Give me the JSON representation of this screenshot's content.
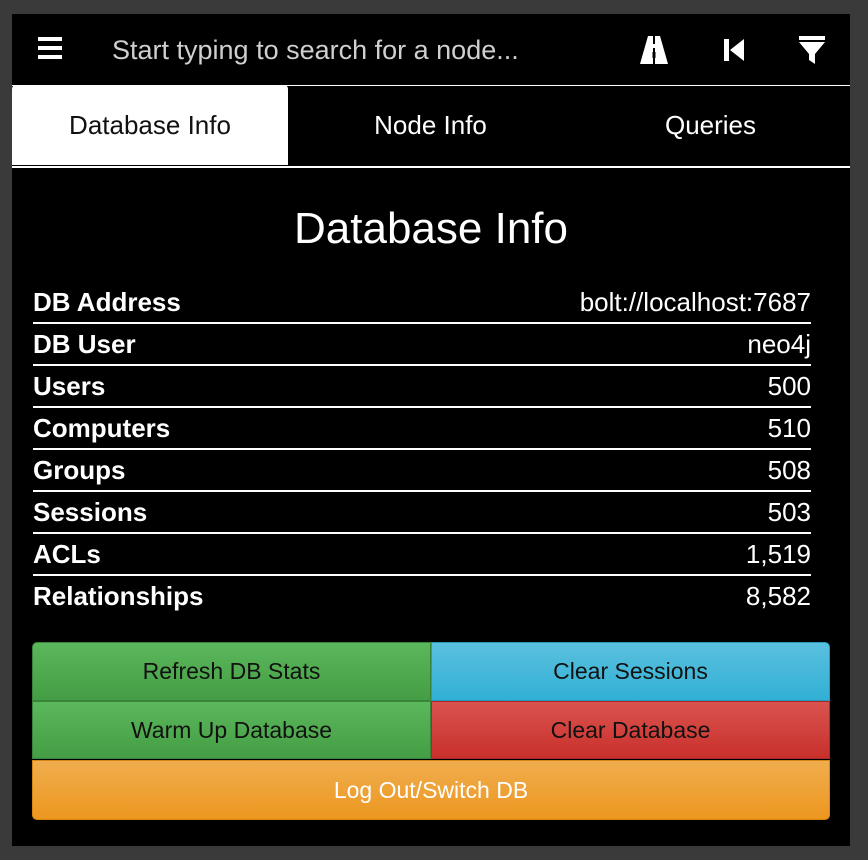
{
  "search": {
    "placeholder": "Start typing to search for a node..."
  },
  "toolbar_icons": [
    "menu-icon",
    "pathfinding-icon",
    "back-icon",
    "filter-icon"
  ],
  "tabs": [
    {
      "label": "Database Info",
      "active": true
    },
    {
      "label": "Node Info",
      "active": false
    },
    {
      "label": "Queries",
      "active": false
    }
  ],
  "main": {
    "title": "Database Info",
    "rows": [
      {
        "label": "DB Address",
        "value": "bolt://localhost:7687"
      },
      {
        "label": "DB User",
        "value": "neo4j"
      },
      {
        "label": "Users",
        "value": "500"
      },
      {
        "label": "Computers",
        "value": "510"
      },
      {
        "label": "Groups",
        "value": "508"
      },
      {
        "label": "Sessions",
        "value": "503"
      },
      {
        "label": "ACLs",
        "value": "1,519"
      },
      {
        "label": "Relationships",
        "value": "8,582"
      }
    ]
  },
  "buttons": {
    "refresh": "Refresh DB Stats",
    "clear_sessions": "Clear Sessions",
    "warm_up": "Warm Up Database",
    "clear_database": "Clear Database",
    "logout": "Log Out/Switch DB"
  },
  "colors": {
    "green": "#5cb85c",
    "blue": "#5bc0de",
    "red": "#d9534f",
    "orange": "#f0ad4e",
    "background": "#000000"
  }
}
